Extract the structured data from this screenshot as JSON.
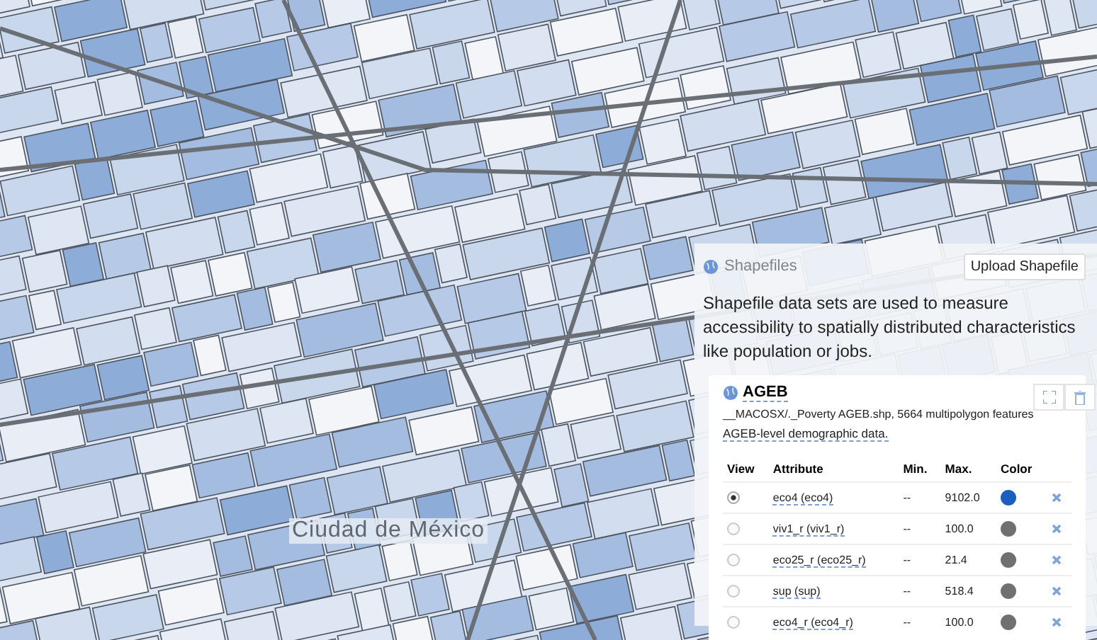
{
  "map": {
    "label": "Ciudad de México"
  },
  "panel": {
    "title": "Shapefiles",
    "upload_button": "Upload Shapefile",
    "description": "Shapefile data sets are used to measure accessibility to spatially distributed characteristics like population or jobs."
  },
  "shapefile": {
    "name": "AGEB",
    "file_info": "__MACOSX/._Poverty AGEB.shp, 5664 multipolygon features",
    "summary": "AGEB-level demographic data.",
    "columns": [
      "View",
      "Attribute",
      "Min.",
      "Max.",
      "Color"
    ],
    "rows": [
      {
        "selected": true,
        "attribute": "eco4 (eco4)",
        "min": "--",
        "max": "9102.0",
        "color": "#1a5fc0"
      },
      {
        "selected": false,
        "attribute": "viv1_r (viv1_r)",
        "min": "--",
        "max": "100.0",
        "color": "#707070"
      },
      {
        "selected": false,
        "attribute": "eco25_r (eco25_r)",
        "min": "--",
        "max": "21.4",
        "color": "#707070"
      },
      {
        "selected": false,
        "attribute": "sup (sup)",
        "min": "--",
        "max": "518.4",
        "color": "#707070"
      },
      {
        "selected": false,
        "attribute": "eco4_r (eco4_r)",
        "min": "--",
        "max": "100.0",
        "color": "#707070"
      }
    ]
  }
}
